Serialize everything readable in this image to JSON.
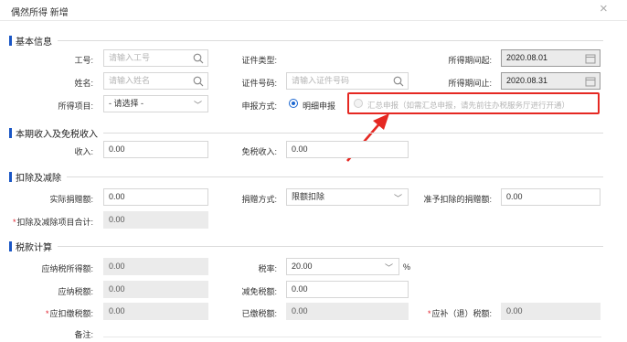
{
  "dialog": {
    "title": "偶然所得 新增",
    "close": "×"
  },
  "sections": {
    "basic": "基本信息",
    "income": "本期收入及免税收入",
    "deduct": "扣除及减除",
    "tax": "税款计算"
  },
  "basic": {
    "job_no_label": "工号:",
    "job_no_placeholder": "请输入工号",
    "id_type_label": "证件类型:",
    "period_start_label": "所得期间起:",
    "period_start": "2020.08.01",
    "name_label": "姓名:",
    "name_placeholder": "请输入姓名",
    "id_no_label": "证件号码:",
    "id_no_placeholder": "请输入证件号码",
    "period_end_label": "所得期间止:",
    "period_end": "2020.08.31",
    "item_label": "所得项目:",
    "item_value": "- 请选择 -",
    "method_label": "申报方式:",
    "method_option1": "明细申报",
    "method_option2": "汇总申报（如需汇总申报，请先前往办税服务厅进行开通）"
  },
  "income": {
    "income_label": "收入:",
    "income_value": "0.00",
    "free_label": "免税收入:",
    "free_value": "0.00"
  },
  "deduct": {
    "donation_label": "实际捐赠额:",
    "donation_value": "0.00",
    "method_label": "捐赠方式:",
    "method_value": "限额扣除",
    "allowed_label": "准予扣除的捐赠额:",
    "allowed_value": "0.00",
    "total_label": "扣除及减除项目合计:",
    "total_value": "0.00"
  },
  "tax": {
    "taxable_label": "应纳税所得额:",
    "taxable_value": "0.00",
    "rate_label": "税率:",
    "rate_value": "20.00",
    "rate_unit": "%",
    "payable_label": "应纳税额:",
    "payable_value": "0.00",
    "relief_label": "减免税额:",
    "relief_value": "0.00",
    "withhold_label": "应扣缴税额:",
    "withhold_value": "0.00",
    "paid_label": "已缴税额:",
    "paid_value": "0.00",
    "refund_label": "应补（退）税额:",
    "refund_value": "0.00",
    "remark_label": "备注:"
  },
  "colors": {
    "accent": "#1a56c5",
    "highlight": "#e52822",
    "required": "#e0212d"
  },
  "icons": [
    "search-icon",
    "calendar-icon",
    "chevron-down-icon",
    "close-icon",
    "arrow-annotation"
  ]
}
